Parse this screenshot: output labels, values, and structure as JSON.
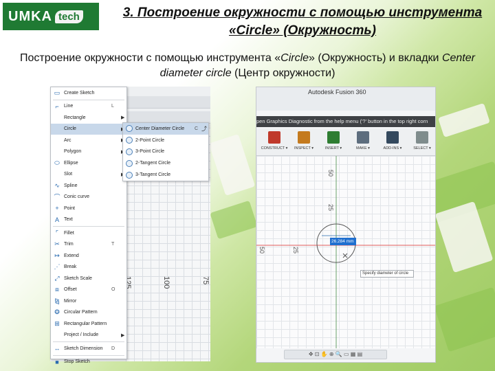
{
  "logo": {
    "main": "UMKA",
    "badge": "tech"
  },
  "title": "3. Построение окружности с помощью инструмента «Circle» (Окружность)",
  "subtitle": {
    "part1": "Построение окружности с помощью инструмента «",
    "italic1": "Circle",
    "part2": "» (Окружность) и вкладки ",
    "italic2": "Center diameter circle",
    "part3": " (Центр окружности)"
  },
  "left_screenshot": {
    "axis_labels": [
      "125",
      "100",
      "75"
    ],
    "menu": {
      "items": [
        {
          "label": "Create Sketch",
          "icon": "create-sketch-icon",
          "shortcut": "",
          "arrow": false
        },
        {
          "sep": true
        },
        {
          "label": "Line",
          "icon": "line-icon",
          "shortcut": "L",
          "arrow": false
        },
        {
          "label": "Rectangle",
          "icon": "",
          "shortcut": "",
          "arrow": true
        },
        {
          "label": "Circle",
          "icon": "",
          "shortcut": "",
          "arrow": true,
          "selected": true
        },
        {
          "label": "Arc",
          "icon": "",
          "shortcut": "",
          "arrow": true
        },
        {
          "label": "Polygon",
          "icon": "",
          "shortcut": "",
          "arrow": true
        },
        {
          "label": "Ellipse",
          "icon": "ellipse-icon",
          "shortcut": "",
          "arrow": false
        },
        {
          "label": "Slot",
          "icon": "",
          "shortcut": "",
          "arrow": true
        },
        {
          "label": "Spline",
          "icon": "spline-icon",
          "shortcut": "",
          "arrow": false
        },
        {
          "label": "Conic curve",
          "icon": "conic-curve-icon",
          "shortcut": "",
          "arrow": false
        },
        {
          "label": "Point",
          "icon": "point-icon",
          "shortcut": "",
          "arrow": false
        },
        {
          "label": "Text",
          "icon": "text-icon",
          "shortcut": "",
          "arrow": false
        },
        {
          "sep": true
        },
        {
          "label": "Fillet",
          "icon": "fillet-icon",
          "shortcut": "",
          "arrow": false
        },
        {
          "label": "Trim",
          "icon": "trim-icon",
          "shortcut": "T",
          "arrow": false
        },
        {
          "label": "Extend",
          "icon": "extend-icon",
          "shortcut": "",
          "arrow": false
        },
        {
          "label": "Break",
          "icon": "break-icon",
          "shortcut": "",
          "arrow": false
        },
        {
          "label": "Sketch Scale",
          "icon": "sketch-scale-icon",
          "shortcut": "",
          "arrow": false
        },
        {
          "label": "Offset",
          "icon": "offset-icon",
          "shortcut": "O",
          "arrow": false
        },
        {
          "label": "Mirror",
          "icon": "mirror-icon",
          "shortcut": "",
          "arrow": false
        },
        {
          "label": "Circular Pattern",
          "icon": "circular-pattern-icon",
          "shortcut": "",
          "arrow": false
        },
        {
          "label": "Rectangular Pattern",
          "icon": "rectangular-pattern-icon",
          "shortcut": "",
          "arrow": false
        },
        {
          "label": "Project / Include",
          "icon": "",
          "shortcut": "",
          "arrow": true
        },
        {
          "sep": true
        },
        {
          "label": "Sketch Dimension",
          "icon": "sketch-dimension-icon",
          "shortcut": "D",
          "arrow": false
        },
        {
          "sep": true
        },
        {
          "label": "Stop Sketch",
          "icon": "stop-sketch-icon",
          "shortcut": "",
          "arrow": false
        }
      ]
    },
    "submenu": {
      "items": [
        {
          "label": "Center Diameter Circle",
          "shortcut": "C",
          "selected": true
        },
        {
          "label": "2-Point Circle",
          "shortcut": ""
        },
        {
          "label": "3-Point Circle",
          "shortcut": ""
        },
        {
          "label": "2-Tangent Circle",
          "shortcut": ""
        },
        {
          "label": "3-Tangent Circle",
          "shortcut": ""
        }
      ]
    }
  },
  "right_screenshot": {
    "app_title": "Autodesk Fusion 360",
    "banner": "pen Graphics Diagnostic from the help menu ('?' button in the top right corn",
    "toolbar": [
      {
        "label": "CONSTRUCT ▾",
        "color": "#c0392b"
      },
      {
        "label": "INSPECT ▾",
        "color": "#c47a1e"
      },
      {
        "label": "INSERT ▾",
        "color": "#2e7d32"
      },
      {
        "label": "MAKE ▾",
        "color": "#5d6d7e"
      },
      {
        "label": "ADD-INS ▾",
        "color": "#34495e"
      },
      {
        "label": "SELECT ▾",
        "color": "#7f8c8d"
      }
    ],
    "vertical_labels": [
      "50",
      "25"
    ],
    "horizontal_labels": [
      "50",
      "25"
    ],
    "dimension_value": "26.284 mm",
    "tooltip": "Specify diameter of circle"
  },
  "colors": {
    "logo_bg": "#1f7a33",
    "accent": "#8cc24e",
    "selection": "#c8d8ea",
    "sketch_red": "#e05a5a"
  }
}
